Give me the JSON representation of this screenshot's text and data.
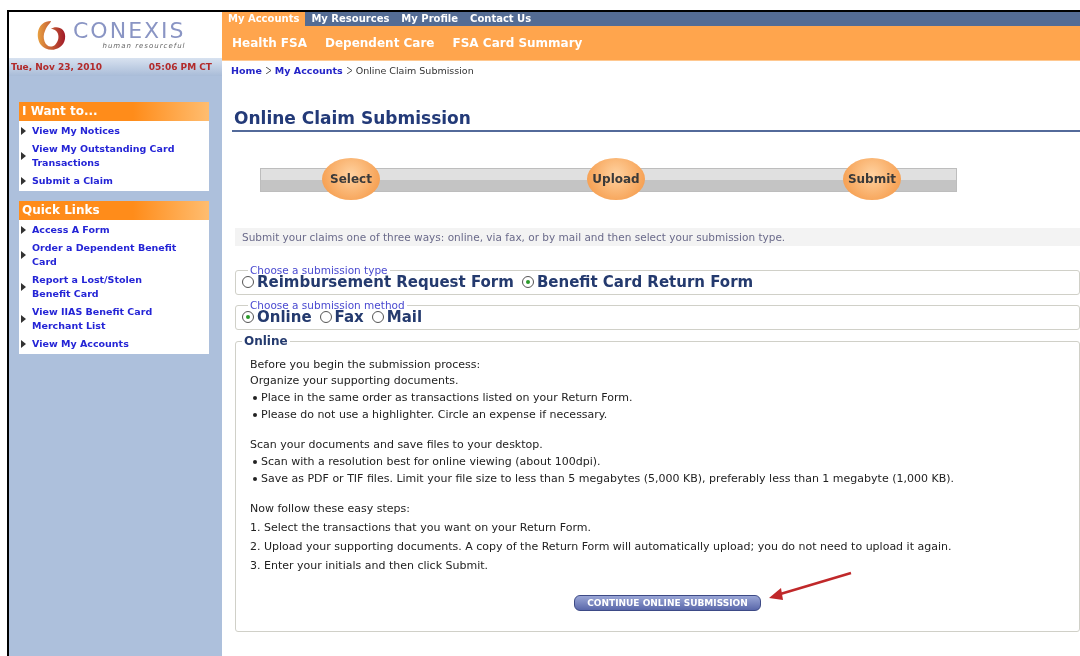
{
  "header": {
    "logo": {
      "name": "CONEXIS",
      "tagline": "human resourceful"
    },
    "top_tabs": [
      {
        "label": "My Accounts",
        "selected": true
      },
      {
        "label": "My Resources",
        "selected": false
      },
      {
        "label": "My Profile",
        "selected": false
      },
      {
        "label": "Contact Us",
        "selected": false
      }
    ],
    "sub_tabs": [
      {
        "label": "Health FSA"
      },
      {
        "label": "Dependent Care"
      },
      {
        "label": "FSA Card Summary"
      }
    ],
    "date": "Tue, Nov 23, 2010",
    "time": "05:06 PM CT"
  },
  "breadcrumb": [
    {
      "label": "Home",
      "kind": "link"
    },
    {
      "label": "My Accounts",
      "kind": "link"
    },
    {
      "label": "Online Claim Submission",
      "kind": "current"
    }
  ],
  "sidebar": {
    "panels": [
      {
        "title": "I Want to...",
        "items": [
          "View My Notices",
          "View My Outstanding Card Transactions",
          "Submit a Claim"
        ]
      },
      {
        "title": "Quick Links",
        "items": [
          "Access A Form",
          "Order a Dependent Benefit Card",
          "Report a Lost/Stolen Benefit Card",
          "View IIAS Benefit Card Merchant List",
          "View My Accounts"
        ]
      }
    ]
  },
  "page_title": "Online Claim Submission",
  "steps": [
    {
      "label": "Select"
    },
    {
      "label": "Upload"
    },
    {
      "label": "Submit"
    }
  ],
  "intro": "Submit your claims one of three ways: online, via fax, or by mail and then select your submission type.",
  "submission_type": {
    "legend": "Choose a submission type",
    "options": [
      {
        "label": "Reimbursement Request Form",
        "selected": false
      },
      {
        "label": "Benefit Card Return Form",
        "selected": true
      }
    ]
  },
  "submission_method": {
    "legend": "Choose a submission method",
    "options": [
      {
        "label": "Online",
        "selected": true
      },
      {
        "label": "Fax",
        "selected": false
      },
      {
        "label": "Mail",
        "selected": false
      }
    ]
  },
  "online": {
    "legend": "Online",
    "blocks": [
      {
        "kind": "plain",
        "lines": [
          "Before you begin the submission process:"
        ]
      },
      {
        "kind": "bulleted",
        "heading": "Organize your supporting documents.",
        "lines": [
          "Place in the same order as transactions listed on your Return Form.",
          "Please do not use a highlighter. Circle an expense if necessary."
        ]
      },
      {
        "kind": "bulleted",
        "heading": "Scan your documents and save files to your desktop.",
        "lines": [
          "Scan with a resolution best for online viewing (about 100dpi).",
          "Save as PDF or TIF files. Limit your file size to less than 5 megabytes (5,000 KB), preferably less than 1 megabyte (1,000 KB)."
        ]
      },
      {
        "kind": "numbered",
        "heading": "Now follow these easy steps:",
        "lines": [
          "1. Select the transactions that you want on your Return Form.",
          "2. Upload your supporting documents. A copy of the Return Form will automatically upload; you do not need to upload it again.",
          "3. Enter your initials and then click Submit."
        ]
      }
    ],
    "button": "CONTINUE ONLINE SUBMISSION"
  }
}
